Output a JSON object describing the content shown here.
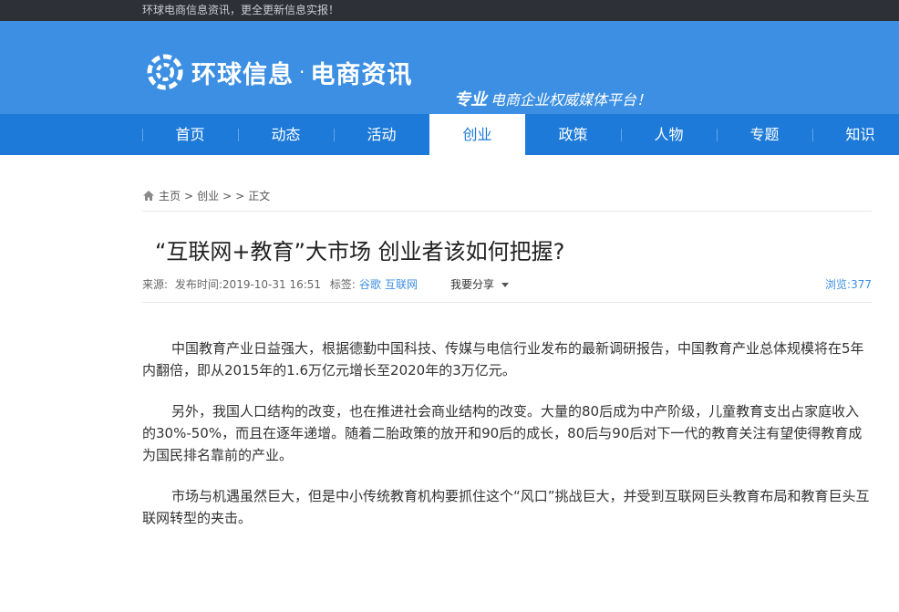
{
  "topbar": {
    "text": "环球电商信息资讯，更全更新信息实报！"
  },
  "header": {
    "brand": "环球信息",
    "separator": "·",
    "channel": "电商资讯",
    "slogan_bold": "专业",
    "slogan_rest": "电商企业权威媒体平台！",
    "colors": {
      "header_bg": "#3c8fe2",
      "nav_bg": "#1d7ad8"
    }
  },
  "nav": {
    "items": [
      {
        "label": "首页"
      },
      {
        "label": "动态"
      },
      {
        "label": "活动"
      },
      {
        "label": "创业"
      },
      {
        "label": "政策"
      },
      {
        "label": "人物"
      },
      {
        "label": "专题"
      },
      {
        "label": "知识"
      }
    ],
    "active": "创业"
  },
  "breadcrumb": {
    "icon": "home-icon",
    "home": "主页",
    "sep1": ">",
    "section": "创业",
    "sep2": ">",
    "sep3": ">",
    "current": "正文"
  },
  "article": {
    "title": "“互联网+教育”大市场 创业者该如何把握?",
    "meta": {
      "source_label": "来源:",
      "time_label": "发布时间:",
      "time": "2019-10-31 16:51",
      "tags_label": "标签:",
      "tags": [
        "谷歌",
        "互联网"
      ],
      "share_label": "我要分享",
      "views_label": "浏览:",
      "views": "377"
    },
    "paragraphs": [
      "中国教育产业日益强大，根据德勤中国科技、传媒与电信行业发布的最新调研报告，中国教育产业总体规模将在5年内翻倍，即从2015年的1.6万亿元增长至2020年的3万亿元。",
      "另外，我国人口结构的改变，也在推进社会商业结构的改变。大量的80后成为中产阶级，儿童教育支出占家庭收入的30%-50%，而且在逐年递增。随着二胎政策的放开和90后的成长，80后与90后对下一代的教育关注有望使得教育成为国民排名靠前的产业。",
      "市场与机遇虽然巨大，但是中小传统教育机构要抓住这个“风口”挑战巨大，并受到互联网巨头教育布局和教育巨头互联网转型的夹击。"
    ]
  }
}
